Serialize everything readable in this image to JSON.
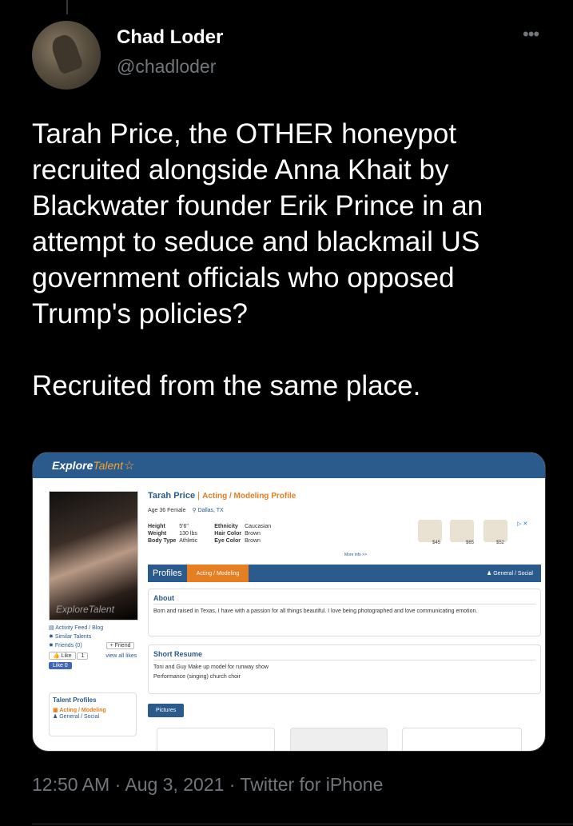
{
  "tweet": {
    "author_name": "Chad Loder",
    "author_handle": "@chadloder",
    "more_glyph": "•••",
    "text": "Tarah Price, the OTHER honeypot recruited alongside Anna Khait by Blackwater founder Erik Prince in an attempt to seduce and blackmail US government officials who opposed Trump's policies?\n\nRecruited from the same place.",
    "timestamp": "12:50 AM · Aug 3, 2021 · Twitter for iPhone"
  },
  "embedded_page": {
    "site_logo_part1": "Explore",
    "site_logo_part2": "Talent",
    "photo_watermark": "ExploreTalent",
    "profile_name": "Tarah Price",
    "profile_separator": "|",
    "profile_type": "Acting / Modeling Profile",
    "age_gender": "Age 36 Female",
    "location": "Dallas, TX",
    "stats": [
      {
        "k1": "Height",
        "v1": "5'6\"",
        "k2": "Ethnicity",
        "v2": "Caucasian"
      },
      {
        "k1": "Weight",
        "v1": "130 lbs",
        "k2": "Hair Color",
        "v2": "Brown"
      },
      {
        "k1": "Body Type",
        "v1": "Athletic",
        "k2": "Eye Color",
        "v2": "Brown"
      }
    ],
    "more_info": "More info >>",
    "ad_prices": [
      "$45",
      "$65",
      "$52"
    ],
    "ad_mark": "▷ ✕",
    "sidebar": {
      "activity": "Activity Feed / Blog",
      "similar": "Similar Talents",
      "friends": "Friends (0)",
      "add_friend": "+ Friend",
      "like": "Like",
      "like_count": "1",
      "view_likes": "view all likes",
      "fb_like": "Like 0"
    },
    "talent_profiles": {
      "heading": "Talent Profiles",
      "acting": "Acting / Modeling",
      "general": "General / Social"
    },
    "tabs": {
      "profiles": "Profiles",
      "acting": "Acting / Modeling",
      "general": "General / Social"
    },
    "about": {
      "heading": "About",
      "text": "Born and raised in Texas, I have with a passion for all things beautiful. I love being photographed and love communicating emotion."
    },
    "resume": {
      "heading": "Short Resume",
      "line1": "Toni and Guy Make up model for runway show",
      "line2": "Performance (singing) church choir"
    },
    "pictures_button": "Pictures"
  }
}
